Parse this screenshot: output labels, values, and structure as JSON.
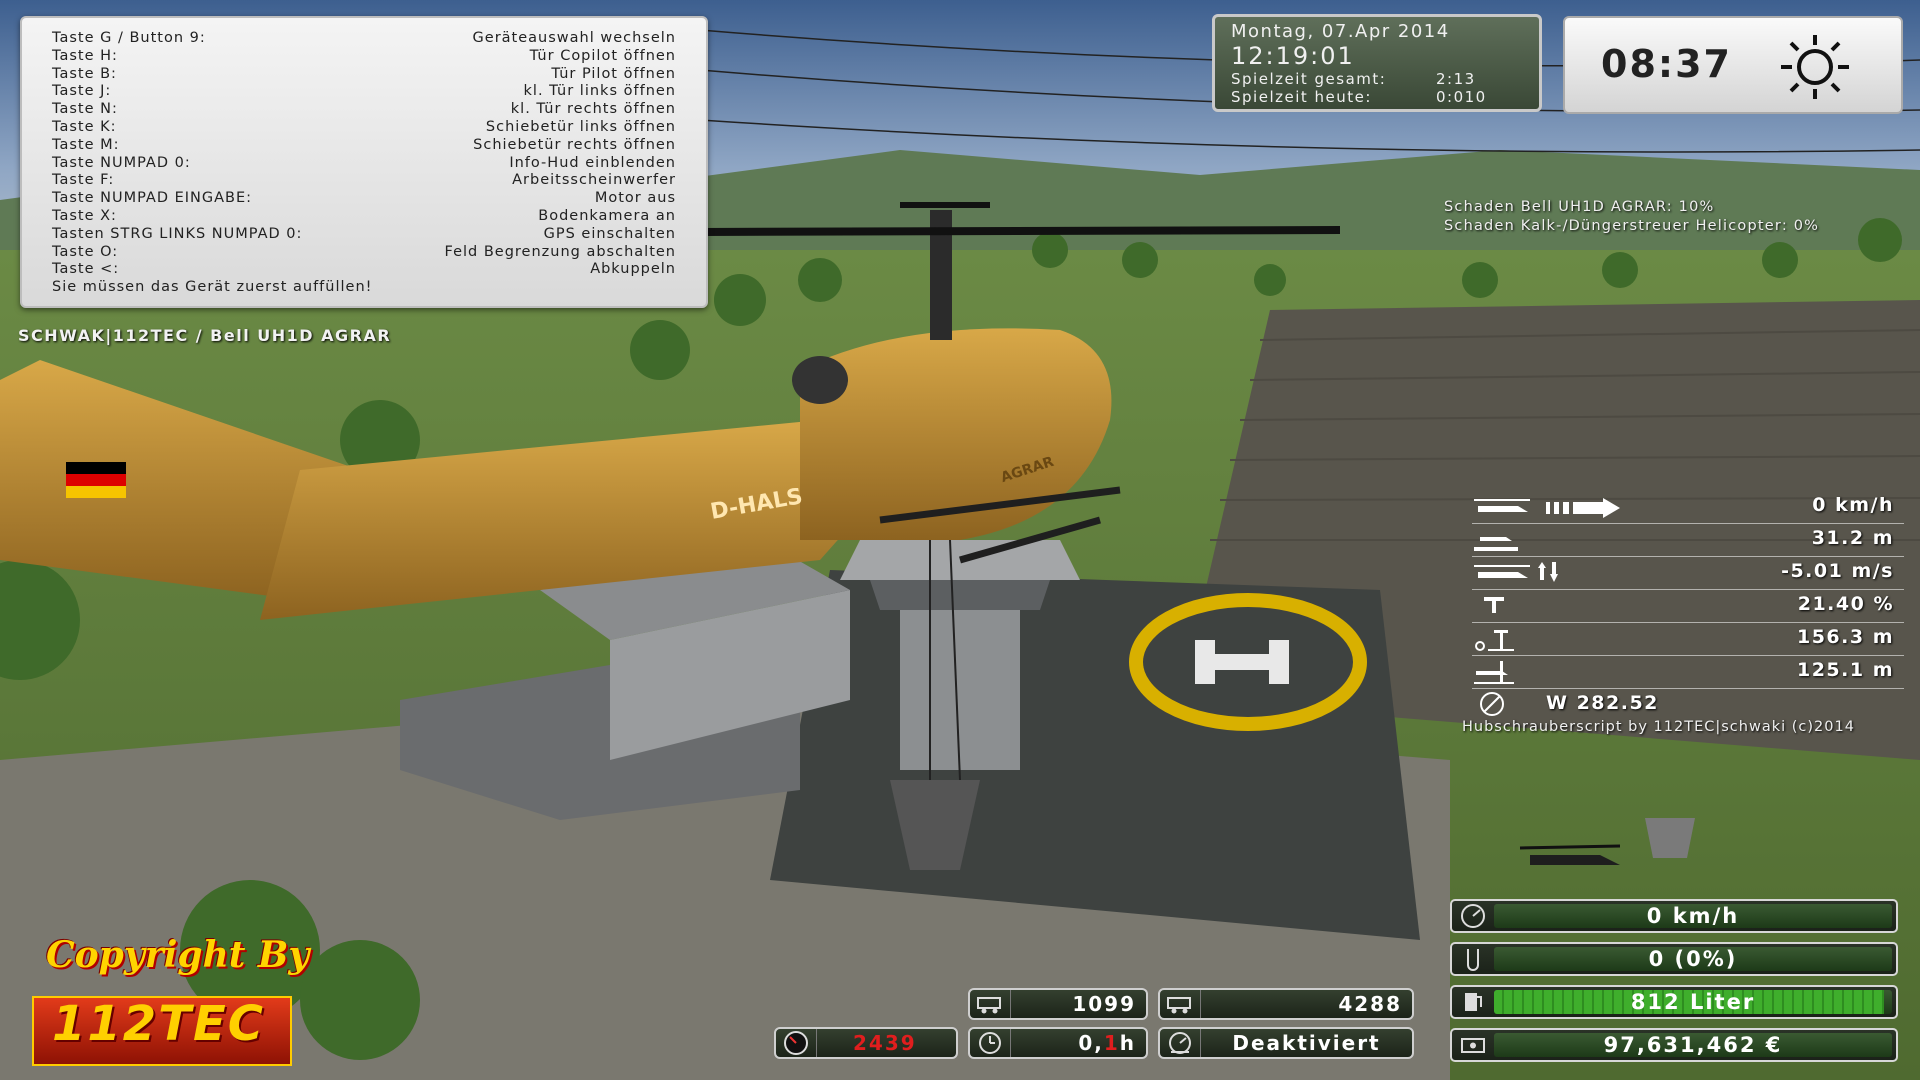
{
  "help_panel": {
    "rows": [
      {
        "key": "Taste G / Button 9:",
        "action": "Geräteauswahl wechseln"
      },
      {
        "key": "Taste H:",
        "action": "Tür Copilot öffnen"
      },
      {
        "key": "Taste B:",
        "action": "Tür Pilot öffnen"
      },
      {
        "key": "Taste J:",
        "action": "kl. Tür links öffnen"
      },
      {
        "key": "Taste N:",
        "action": "kl. Tür rechts öffnen"
      },
      {
        "key": "Taste K:",
        "action": "Schiebetür links öffnen"
      },
      {
        "key": "Taste M:",
        "action": "Schiebetür rechts öffnen"
      },
      {
        "key": "Taste NUMPAD 0:",
        "action": "Info-Hud einblenden"
      },
      {
        "key": "Taste F:",
        "action": "Arbeitsscheinwerfer"
      },
      {
        "key": "Taste NUMPAD EINGABE:",
        "action": "Motor aus"
      },
      {
        "key": "Taste X:",
        "action": "Bodenkamera an"
      },
      {
        "key": "Tasten STRG LINKS NUMPAD 0:",
        "action": "GPS einschalten"
      },
      {
        "key": "Taste O:",
        "action": "Feld Begrenzung abschalten"
      },
      {
        "key": "Taste <:",
        "action": "Abkuppeln"
      }
    ],
    "note": "Sie müssen das Gerät zuerst auffüllen!"
  },
  "vehicle_name": "SCHWAK|112TEC / Bell UH1D AGRAR",
  "date_panel": {
    "date": "Montag, 07.Apr 2014",
    "time": "12:19:01",
    "total_label": "Spielzeit gesamt:",
    "total_value": "2:13",
    "today_label": "Spielzeit heute:",
    "today_value": "0:010"
  },
  "clock": {
    "time": "08:37",
    "weather_icon": "sun-icon"
  },
  "damage": [
    "Schaden Bell UH1D AGRAR: 10%",
    "Schaden Kalk-/Düngerstreuer Helicopter: 0%"
  ],
  "heli_hud": {
    "speed": "0 km/h",
    "altitude": "31.2 m",
    "vertical_speed": "-5.01 m/s",
    "rotor_pitch": "21.40 %",
    "height_2": "156.3 m",
    "height_3": "125.1 m",
    "compass": "W 282.52",
    "credit": "Hubschrauberscript by 112TEC|schwaki (c)2014"
  },
  "status_bars": {
    "speed": "0 km/h",
    "fill_level": "0 (0%)",
    "fuel": "812 Liter",
    "fuel_fraction": 0.98,
    "money": "97,631,462 €"
  },
  "small_bars": {
    "counter_1": "1099",
    "counter_2": "4288",
    "rpm": "2439",
    "hours_main": "0,",
    "hours_red": "1",
    "hours_unit": "h",
    "cruise": "Deaktiviert"
  },
  "copyright": {
    "line1": "Copyright By",
    "logo": "112TEC"
  },
  "aircraft": {
    "registration": "D-HALS",
    "label": "AGRAR"
  }
}
